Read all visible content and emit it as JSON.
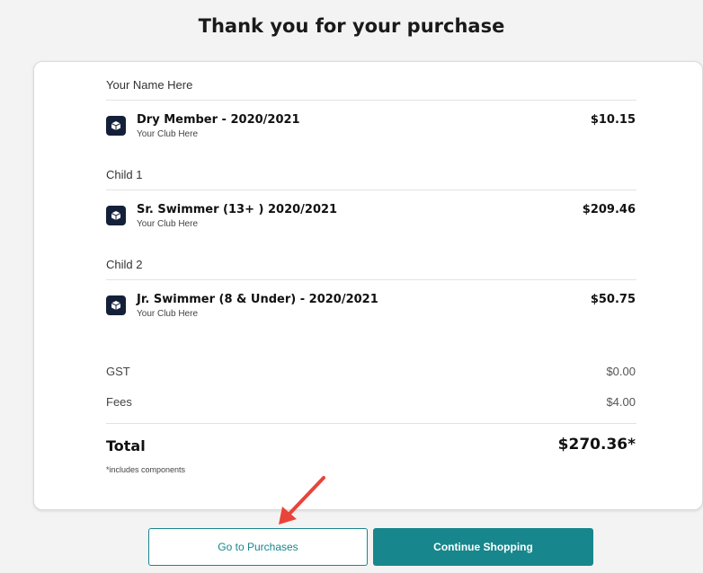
{
  "header": {
    "title": "Thank you for your purchase"
  },
  "members": [
    {
      "name": "Your Name Here",
      "item": {
        "title": "Dry Member - 2020/2021",
        "club": "Your Club Here",
        "price": "$10.15"
      }
    },
    {
      "name": "Child 1",
      "item": {
        "title": "Sr. Swimmer (13+ ) 2020/2021",
        "club": "Your Club Here",
        "price": "$209.46"
      }
    },
    {
      "name": "Child 2",
      "item": {
        "title": "Jr. Swimmer (8 & Under) - 2020/2021",
        "club": "Your Club Here",
        "price": "$50.75"
      }
    }
  ],
  "summary": {
    "gst_label": "GST",
    "gst_value": "$0.00",
    "fees_label": "Fees",
    "fees_value": "$4.00",
    "total_label": "Total",
    "total_value": "$270.36*",
    "total_note": "*includes components"
  },
  "actions": {
    "purchases_label": "Go to Purchases",
    "continue_label": "Continue Shopping"
  },
  "colors": {
    "accent": "#17878d",
    "icon_bg": "#14203a",
    "arrow": "#e8443a"
  },
  "icons": {
    "item_icon": "cube-icon",
    "annotation": "red-arrow-icon"
  }
}
